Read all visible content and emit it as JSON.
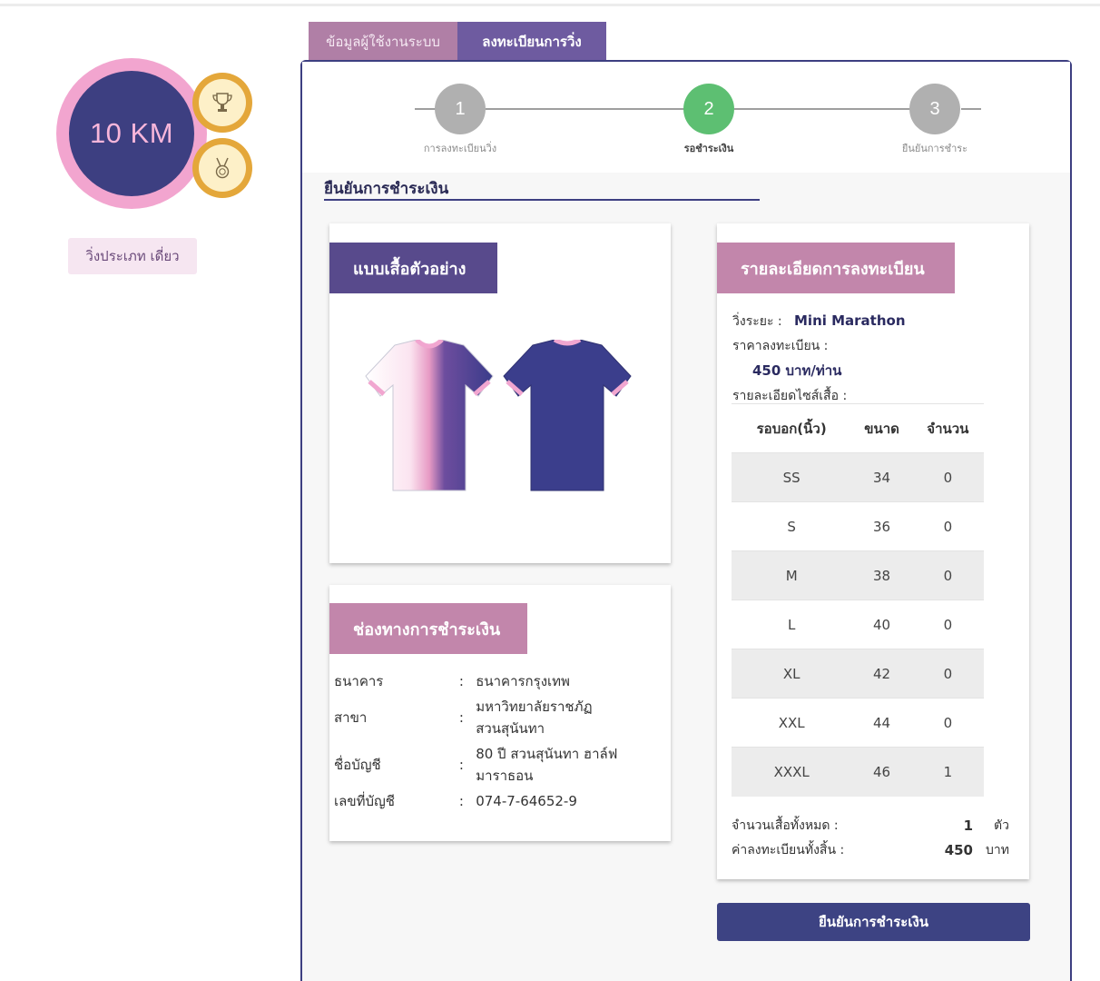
{
  "badge": {
    "distance": "10 KM",
    "trophy_icon": "trophy-icon",
    "medal_icon": "medal-icon",
    "run_type": "วิ่งประเภท เดี่ยว"
  },
  "tabs": [
    {
      "label": "ข้อมูลผู้ใช้งานระบบ",
      "active": false
    },
    {
      "label": "ลงทะเบียนการวิ่ง",
      "active": true
    }
  ],
  "stepper": {
    "steps": [
      {
        "number": "1",
        "label": "การลงทะเบียนวิ่ง",
        "color": "#b0b0b0"
      },
      {
        "number": "2",
        "label": "รอชำระเงิน",
        "color": "#5dbf72"
      },
      {
        "number": "3",
        "label": "ยืนยันการชำระ",
        "color": "#b0b0b0"
      }
    ]
  },
  "section_title": "ยืนยันการชำระเงิน",
  "shirt_card": {
    "title": "แบบเสื้อตัวอย่าง"
  },
  "payment_card": {
    "title": "ช่องทางการชำระเงิน",
    "rows": [
      {
        "key": "ธนาคาร",
        "sep": ":",
        "value": "ธนาคารกรุงเทพ"
      },
      {
        "key": "สาขา",
        "sep": ":",
        "value": "มหาวิทยาลัยราชภัฏ สวนสุนันทา"
      },
      {
        "key": "ชื่อบัญชี",
        "sep": ":",
        "value": "80 ปี สวนสุนันทา ฮาล์ฟ มาราธอน"
      },
      {
        "key": "เลขที่บัญชี",
        "sep": ":",
        "value": "074-7-64652-9"
      }
    ]
  },
  "registration_card": {
    "title": "รายละเอียดการลงทะเบียน",
    "distance_label": "วิ่งระยะ :",
    "distance_value": "Mini Marathon",
    "price_label": "ราคาลงทะเบียน :",
    "price_value": "450 บาท/ท่าน",
    "size_detail_label": "รายละเอียดไซส์เสื้อ :",
    "size_table": {
      "headers": [
        "รอบอก(นิ้ว)",
        "ขนาด",
        "จำนวน"
      ],
      "rows": [
        [
          "SS",
          "34",
          "0"
        ],
        [
          "S",
          "36",
          "0"
        ],
        [
          "M",
          "38",
          "0"
        ],
        [
          "L",
          "40",
          "0"
        ],
        [
          "XL",
          "42",
          "0"
        ],
        [
          "XXL",
          "44",
          "0"
        ],
        [
          "XXXL",
          "46",
          "1"
        ]
      ]
    },
    "total_shirts_label": "จำนวนเสื้อทั้งหมด :",
    "total_shirts_value": "1",
    "total_shirts_unit": "ตัว",
    "total_fee_label": "ค่าลงทะเบียนทั้งสิ้น :",
    "total_fee_value": "450",
    "total_fee_unit": "บาท"
  },
  "confirm_button": "ยืนยันการชำระเงิน",
  "colors": {
    "primary": "#3d3f81",
    "pink": "#f2a5cf",
    "accent_pink": "#c286ab",
    "purple_header": "#584a8c",
    "medal_gold": "#e4a73a",
    "step_active": "#5dbf72",
    "step_inactive": "#b0b0b0"
  }
}
